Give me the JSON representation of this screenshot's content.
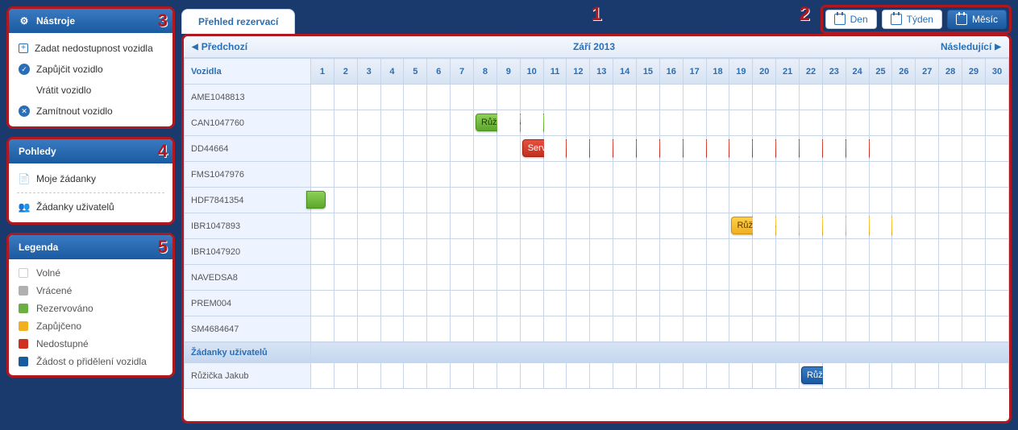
{
  "annotations": {
    "n1": "1",
    "n2": "2",
    "n3": "3",
    "n4": "4",
    "n5": "5"
  },
  "sidebar": {
    "tools": {
      "title": "Nástroje",
      "items": [
        {
          "label": "Zadat nedostupnost vozidla",
          "icon": "plus"
        },
        {
          "label": "Zapůjčit vozidlo",
          "icon": "check"
        },
        {
          "label": "Vrátit vozidlo",
          "icon": ""
        },
        {
          "label": "Zamítnout vozidlo",
          "icon": "x"
        }
      ]
    },
    "views": {
      "title": "Pohledy",
      "items": [
        {
          "label": "Moje žádanky",
          "icon": "doc"
        },
        {
          "label": "Žádanky uživatelů",
          "icon": "users"
        }
      ]
    },
    "legend": {
      "title": "Legenda",
      "items": [
        {
          "label": "Volné",
          "color": "#ffffff"
        },
        {
          "label": "Vrácené",
          "color": "#b0b0b0"
        },
        {
          "label": "Rezervováno",
          "color": "#6ab040"
        },
        {
          "label": "Zapůjčeno",
          "color": "#f0b020"
        },
        {
          "label": "Nedostupné",
          "color": "#d03020"
        },
        {
          "label": "Žádost o přidělení vozidla",
          "color": "#1a5aa0"
        }
      ]
    }
  },
  "main": {
    "tab": "Přehled rezervací",
    "viewSwitch": {
      "day": "Den",
      "week": "Týden",
      "month": "Měsíc"
    },
    "nav": {
      "prev": "Předchozí",
      "title": "Září 2013",
      "next": "Následující"
    },
    "headerCol": "Vozidla",
    "days": [
      "1",
      "2",
      "3",
      "4",
      "5",
      "6",
      "7",
      "8",
      "9",
      "10",
      "11",
      "12",
      "13",
      "14",
      "15",
      "16",
      "17",
      "18",
      "19",
      "20",
      "21",
      "22",
      "23",
      "24",
      "25",
      "26",
      "27",
      "28",
      "29",
      "30"
    ],
    "vehicles": [
      "AME1048813",
      "CAN1047760",
      "DD44664",
      "FMS1047976",
      "HDF7841354",
      "IBR1047893",
      "IBR1047920",
      "NAVEDSA8",
      "PREM004",
      "SM4684647"
    ],
    "sectionLabel": "Žádanky uživatelů",
    "requests": [
      "Růžička Jakub"
    ],
    "bars": [
      {
        "rowType": "vehicle",
        "row": 1,
        "startDay": 8,
        "span": 4,
        "color": "green",
        "label": "Růžička Jakub"
      },
      {
        "rowType": "vehicle",
        "row": 2,
        "startDay": 10,
        "span": 16,
        "color": "red",
        "label": "Servis"
      },
      {
        "rowType": "vehicle",
        "row": 4,
        "startDay": 1,
        "span": 1,
        "color": "green",
        "label": "",
        "stub": true
      },
      {
        "rowType": "vehicle",
        "row": 5,
        "startDay": 19,
        "span": 8,
        "color": "yellow",
        "label": "Růžička Jakub"
      },
      {
        "rowType": "request",
        "row": 0,
        "startDay": 22,
        "span": 2,
        "color": "blue",
        "label": "Růžička"
      }
    ]
  }
}
